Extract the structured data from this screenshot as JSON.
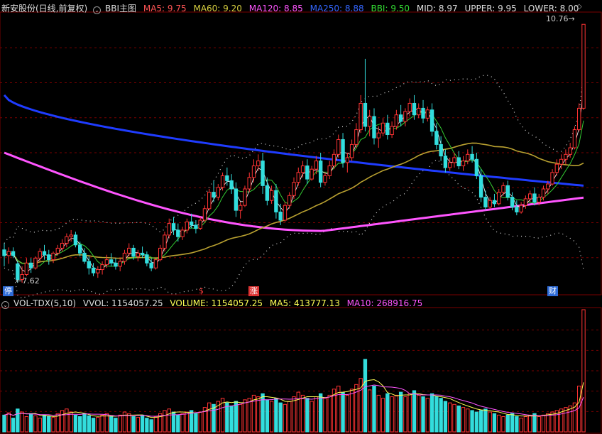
{
  "main": {
    "stock_title": "新安股份(日线,前复权)",
    "indicator_name": "BBI主图",
    "indicators": [
      {
        "label": "MA5: 9.75",
        "color": "#ff5555"
      },
      {
        "label": "MA60: 9.20",
        "color": "#d8d040"
      },
      {
        "label": "MA120: 8.85",
        "color": "#ff55ff"
      },
      {
        "label": "MA250: 8.88",
        "color": "#3366ff"
      },
      {
        "label": "BBI: 9.50",
        "color": "#33dd33"
      },
      {
        "label": "MID: 8.97",
        "color": "#dddddd"
      },
      {
        "label": "UPPER: 9.95",
        "color": "#dddddd"
      },
      {
        "label": "LOWER: 8.00",
        "color": "#dddddd"
      }
    ],
    "low_label": "7.62",
    "high_label": "10.76",
    "marker_ting": "停",
    "marker_s": "$",
    "marker_zhang": "涨",
    "marker_cai": "财"
  },
  "sub": {
    "title": "VOL-TDX(5,10)",
    "indicators": [
      {
        "label": "VVOL: 1154057.25",
        "color": "#dddddd"
      },
      {
        "label": "VOLUME: 1154057.25",
        "color": "#ffff55"
      },
      {
        "label": "MA5: 413777.13",
        "color": "#ffff55"
      },
      {
        "label": "MA10: 268916.75",
        "color": "#ff55ff"
      }
    ]
  },
  "colors": {
    "up": "#ff3333",
    "down": "#33dddd",
    "ma5": "#ffffff",
    "bbi": "#33cc33",
    "ma60": "#b8a030",
    "ma120": "#ff55ff",
    "ma250": "#1f3cff",
    "band": "#dddddd",
    "grid": "#7a0000"
  },
  "chart_data": {
    "type": "candlestick",
    "series": [
      {
        "name": "K",
        "candles": [
          [
            8.02,
            8.1,
            7.82,
            7.95
          ],
          [
            7.95,
            8.05,
            7.85,
            8.0
          ],
          [
            8.0,
            8.05,
            7.92,
            7.95
          ],
          [
            7.85,
            7.88,
            7.62,
            7.66
          ],
          [
            7.66,
            7.82,
            7.62,
            7.72
          ],
          [
            7.72,
            7.92,
            7.7,
            7.86
          ],
          [
            7.86,
            7.92,
            7.74,
            7.8
          ],
          [
            7.8,
            7.94,
            7.78,
            7.92
          ],
          [
            7.92,
            8.04,
            7.88,
            8.0
          ],
          [
            8.0,
            8.08,
            7.9,
            7.96
          ],
          [
            7.96,
            8.02,
            7.84,
            7.9
          ],
          [
            7.9,
            8.0,
            7.86,
            7.98
          ],
          [
            7.98,
            8.08,
            7.95,
            8.04
          ],
          [
            8.04,
            8.15,
            8.0,
            8.1
          ],
          [
            8.1,
            8.22,
            8.05,
            8.18
          ],
          [
            8.18,
            8.26,
            8.12,
            8.2
          ],
          [
            8.2,
            8.24,
            8.05,
            8.08
          ],
          [
            8.08,
            8.12,
            7.94,
            7.98
          ],
          [
            7.98,
            8.04,
            7.85,
            7.88
          ],
          [
            7.88,
            7.94,
            7.72,
            7.8
          ],
          [
            7.8,
            7.86,
            7.7,
            7.74
          ],
          [
            7.74,
            7.82,
            7.68,
            7.78
          ],
          [
            7.78,
            7.88,
            7.72,
            7.84
          ],
          [
            7.84,
            7.96,
            7.8,
            7.9
          ],
          [
            7.9,
            7.98,
            7.82,
            7.86
          ],
          [
            7.86,
            7.92,
            7.78,
            7.82
          ],
          [
            7.82,
            7.92,
            7.76,
            7.88
          ],
          [
            7.88,
            8.02,
            7.84,
            7.98
          ],
          [
            7.98,
            8.1,
            7.94,
            8.04
          ],
          [
            8.04,
            8.08,
            7.9,
            7.94
          ],
          [
            7.94,
            8.02,
            7.88,
            7.98
          ],
          [
            7.98,
            8.06,
            7.92,
            7.96
          ],
          [
            7.96,
            8.0,
            7.82,
            7.86
          ],
          [
            7.86,
            7.92,
            7.76,
            7.8
          ],
          [
            7.8,
            7.92,
            7.78,
            7.9
          ],
          [
            7.9,
            8.08,
            7.88,
            8.04
          ],
          [
            8.04,
            8.24,
            8.0,
            8.2
          ],
          [
            8.2,
            8.4,
            8.16,
            8.34
          ],
          [
            8.34,
            8.42,
            8.2,
            8.26
          ],
          [
            8.26,
            8.34,
            8.12,
            8.18
          ],
          [
            8.18,
            8.3,
            8.14,
            8.26
          ],
          [
            8.26,
            8.4,
            8.22,
            8.36
          ],
          [
            8.36,
            8.46,
            8.28,
            8.32
          ],
          [
            8.32,
            8.38,
            8.22,
            8.28
          ],
          [
            8.28,
            8.42,
            8.26,
            8.38
          ],
          [
            8.38,
            8.56,
            8.36,
            8.52
          ],
          [
            8.52,
            8.76,
            8.5,
            8.72
          ],
          [
            8.72,
            8.86,
            8.6,
            8.66
          ],
          [
            8.66,
            8.82,
            8.62,
            8.78
          ],
          [
            8.78,
            8.96,
            8.74,
            8.92
          ],
          [
            8.92,
            9.02,
            8.8,
            8.86
          ],
          [
            8.86,
            8.94,
            8.7,
            8.76
          ],
          [
            8.76,
            8.84,
            8.42,
            8.5
          ],
          [
            8.5,
            8.6,
            8.4,
            8.56
          ],
          [
            8.56,
            8.8,
            8.54,
            8.76
          ],
          [
            8.76,
            8.96,
            8.72,
            8.9
          ],
          [
            8.9,
            9.12,
            8.84,
            9.04
          ],
          [
            9.04,
            9.18,
            8.98,
            9.1
          ],
          [
            9.1,
            9.2,
            8.7,
            8.8
          ],
          [
            8.8,
            8.9,
            8.56,
            8.62
          ],
          [
            8.62,
            8.8,
            8.58,
            8.74
          ],
          [
            8.74,
            8.82,
            8.4,
            8.48
          ],
          [
            8.48,
            8.58,
            8.32,
            8.38
          ],
          [
            8.38,
            8.6,
            8.36,
            8.56
          ],
          [
            8.56,
            8.72,
            8.52,
            8.68
          ],
          [
            8.68,
            8.9,
            8.64,
            8.84
          ],
          [
            8.84,
            9.02,
            8.8,
            8.96
          ],
          [
            8.96,
            9.1,
            8.9,
            9.04
          ],
          [
            9.04,
            9.12,
            8.82,
            8.88
          ],
          [
            8.88,
            9.04,
            8.86,
            9.0
          ],
          [
            9.0,
            9.16,
            8.94,
            9.1
          ],
          [
            9.1,
            9.2,
            8.78,
            8.84
          ],
          [
            8.84,
            8.96,
            8.8,
            8.92
          ],
          [
            8.92,
            9.1,
            8.88,
            9.04
          ],
          [
            9.04,
            9.24,
            9.0,
            9.18
          ],
          [
            9.18,
            9.42,
            9.14,
            9.36
          ],
          [
            9.36,
            9.44,
            9.02,
            9.08
          ],
          [
            9.08,
            9.2,
            8.96,
            9.14
          ],
          [
            9.14,
            9.36,
            9.1,
            9.3
          ],
          [
            9.3,
            9.56,
            9.26,
            9.48
          ],
          [
            9.48,
            9.9,
            9.44,
            9.8
          ],
          [
            9.8,
            10.34,
            9.46,
            9.52
          ],
          [
            9.52,
            9.72,
            9.4,
            9.64
          ],
          [
            9.64,
            9.74,
            9.3,
            9.38
          ],
          [
            9.38,
            9.52,
            9.26,
            9.44
          ],
          [
            9.44,
            9.62,
            9.4,
            9.56
          ],
          [
            9.56,
            9.66,
            9.36,
            9.42
          ],
          [
            9.42,
            9.58,
            9.38,
            9.52
          ],
          [
            9.52,
            9.72,
            9.48,
            9.66
          ],
          [
            9.66,
            9.78,
            9.52,
            9.58
          ],
          [
            9.58,
            9.74,
            9.52,
            9.7
          ],
          [
            9.7,
            9.86,
            9.64,
            9.8
          ],
          [
            9.8,
            9.9,
            9.6,
            9.66
          ],
          [
            9.66,
            9.8,
            9.62,
            9.74
          ],
          [
            9.74,
            9.84,
            9.56,
            9.62
          ],
          [
            9.62,
            9.76,
            9.58,
            9.72
          ],
          [
            9.72,
            9.8,
            9.4,
            9.46
          ],
          [
            9.46,
            9.56,
            9.24,
            9.3
          ],
          [
            9.3,
            9.4,
            9.1,
            9.16
          ],
          [
            9.16,
            9.24,
            8.96,
            9.02
          ],
          [
            9.02,
            9.14,
            8.98,
            9.08
          ],
          [
            9.08,
            9.2,
            9.02,
            9.14
          ],
          [
            9.14,
            9.22,
            9.0,
            9.04
          ],
          [
            9.04,
            9.16,
            8.98,
            9.1
          ],
          [
            9.1,
            9.24,
            9.06,
            9.18
          ],
          [
            9.18,
            9.28,
            9.08,
            9.12
          ],
          [
            9.12,
            9.2,
            8.88,
            8.92
          ],
          [
            8.92,
            9.0,
            8.6,
            8.66
          ],
          [
            8.66,
            8.74,
            8.5,
            8.54
          ],
          [
            8.54,
            8.66,
            8.52,
            8.62
          ],
          [
            8.62,
            8.7,
            8.54,
            8.58
          ],
          [
            8.58,
            8.76,
            8.56,
            8.72
          ],
          [
            8.72,
            8.84,
            8.68,
            8.8
          ],
          [
            8.8,
            8.86,
            8.62,
            8.66
          ],
          [
            8.66,
            8.72,
            8.5,
            8.54
          ],
          [
            8.54,
            8.62,
            8.44,
            8.48
          ],
          [
            8.48,
            8.6,
            8.46,
            8.56
          ],
          [
            8.56,
            8.68,
            8.52,
            8.64
          ],
          [
            8.64,
            8.74,
            8.6,
            8.7
          ],
          [
            8.7,
            8.78,
            8.56,
            8.6
          ],
          [
            8.6,
            8.7,
            8.56,
            8.66
          ],
          [
            8.66,
            8.8,
            8.62,
            8.76
          ],
          [
            8.76,
            8.86,
            8.7,
            8.82
          ],
          [
            8.82,
            9.0,
            8.8,
            8.96
          ],
          [
            8.96,
            9.12,
            8.92,
            9.06
          ],
          [
            9.06,
            9.18,
            9.0,
            9.12
          ],
          [
            9.12,
            9.24,
            9.06,
            9.18
          ],
          [
            9.18,
            9.32,
            9.14,
            9.26
          ],
          [
            9.26,
            9.52,
            9.24,
            9.48
          ],
          [
            9.48,
            9.8,
            9.46,
            9.74
          ],
          [
            9.74,
            10.76,
            9.72,
            10.76
          ]
        ]
      },
      {
        "name": "VOLUME",
        "values": [
          22,
          25,
          18,
          30,
          26,
          20,
          24,
          21,
          18,
          22,
          20,
          19,
          24,
          28,
          30,
          26,
          22,
          20,
          24,
          21,
          18,
          19,
          22,
          24,
          20,
          18,
          22,
          26,
          24,
          20,
          19,
          22,
          18,
          16,
          20,
          24,
          28,
          30,
          26,
          22,
          24,
          26,
          28,
          24,
          26,
          32,
          38,
          36,
          40,
          44,
          38,
          34,
          40,
          36,
          42,
          44,
          48,
          46,
          50,
          42,
          40,
          44,
          38,
          36,
          40,
          46,
          52,
          48,
          44,
          40,
          46,
          50,
          44,
          48,
          56,
          60,
          52,
          48,
          56,
          62,
          70,
          95,
          55,
          60,
          48,
          44,
          50,
          46,
          48,
          52,
          46,
          50,
          54,
          48,
          46,
          44,
          50,
          46,
          44,
          40,
          38,
          36,
          34,
          32,
          30,
          28,
          26,
          28,
          30,
          26,
          24,
          22,
          20,
          22,
          24,
          20,
          18,
          20,
          22,
          24,
          20,
          22,
          24,
          26,
          28,
          30,
          32,
          34,
          38,
          60,
          160
        ]
      }
    ],
    "price_range": [
      7.5,
      10.9
    ]
  }
}
